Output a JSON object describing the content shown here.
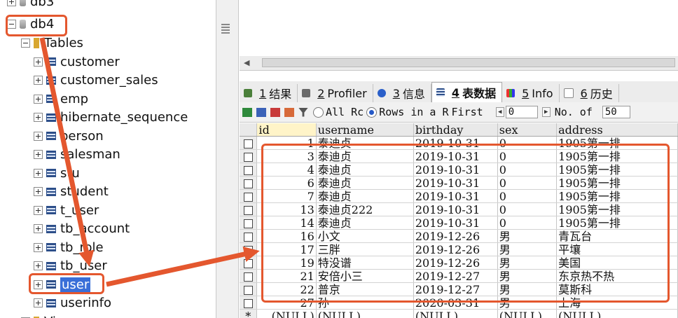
{
  "tree": {
    "db_items": [
      "db3",
      "db4"
    ],
    "tables_folder": "Tables",
    "tables": [
      "customer",
      "customer_sales",
      "emp",
      "hibernate_sequence",
      "person",
      "salesman",
      "stu",
      "student",
      "t_user",
      "tb_account",
      "tb_role",
      "tb_user",
      "user",
      "userinfo"
    ],
    "next_folder": "Vi"
  },
  "tabs": [
    {
      "num": "1",
      "label": "结果"
    },
    {
      "num": "2",
      "label": "Profiler"
    },
    {
      "num": "3",
      "label": "信息"
    },
    {
      "num": "4",
      "label": "表数据"
    },
    {
      "num": "5",
      "label": "Info"
    },
    {
      "num": "6",
      "label": "历史"
    }
  ],
  "toolbar": {
    "all_rows": "All Rc",
    "rows_in_range": "Rows in a R",
    "first_label": "First",
    "first_value": "0",
    "no_of_label": "No. of",
    "no_of_value": "50"
  },
  "grid": {
    "columns": [
      "id",
      "username",
      "birthday",
      "sex",
      "address"
    ],
    "rows": [
      [
        "1",
        "泰迪贞",
        "2019-10-31",
        "0",
        "1905第一排"
      ],
      [
        "3",
        "泰迪贞",
        "2019-10-31",
        "0",
        "1905第一排"
      ],
      [
        "4",
        "泰迪贞",
        "2019-10-31",
        "0",
        "1905第一排"
      ],
      [
        "6",
        "泰迪贞",
        "2019-10-31",
        "0",
        "1905第一排"
      ],
      [
        "7",
        "泰迪贞",
        "2019-10-31",
        "0",
        "1905第一排"
      ],
      [
        "13",
        "泰迪贞222",
        "2019-10-31",
        "0",
        "1905第一排"
      ],
      [
        "14",
        "泰迪贞",
        "2019-10-31",
        "0",
        "1905第一排"
      ],
      [
        "16",
        "小文",
        "2019-12-26",
        "男",
        "青瓦台"
      ],
      [
        "17",
        "三胖",
        "2019-12-26",
        "男",
        "平壤"
      ],
      [
        "19",
        "特没谱",
        "2019-12-26",
        "男",
        "美国"
      ],
      [
        "21",
        "安倍小三",
        "2019-12-27",
        "男",
        "东京热不热"
      ],
      [
        "22",
        "普京",
        "2019-12-27",
        "男",
        "莫斯科"
      ],
      [
        "27",
        "孙",
        "2020-03-31",
        "男",
        "上海"
      ]
    ],
    "new_row_marker": "*",
    "null_text": "(NULL)"
  }
}
